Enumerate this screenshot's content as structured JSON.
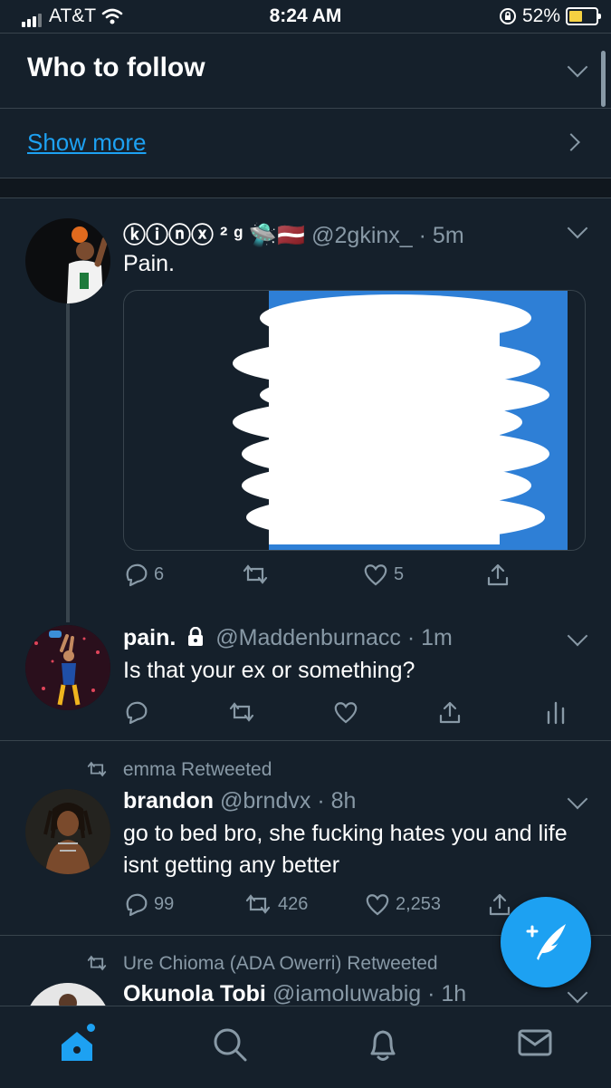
{
  "status_bar": {
    "carrier": "AT&T",
    "time": "8:24 AM",
    "battery_percent": "52%",
    "battery_level": 0.52
  },
  "who_to_follow": {
    "title": "Who to follow",
    "show_more": "Show more"
  },
  "tweets": [
    {
      "display_name": "ⓚⓘⓝⓧ ² ᵍ 🛸🇱🇻",
      "handle": "@2gkinx_",
      "time": "· 5m",
      "text": "Pain.",
      "replies": "6",
      "retweets": "",
      "likes": "5"
    },
    {
      "display_name": "pain.",
      "handle": "@Maddenburnacc",
      "time": "· 1m",
      "text": "Is that your ex or something?",
      "replies": "",
      "retweets": "",
      "likes": ""
    },
    {
      "retweeted_by": "emma Retweeted",
      "display_name": "brandon",
      "handle": "@brndvx",
      "time": "· 8h",
      "text": "go to bed bro, she fucking hates you and life isnt getting any better",
      "replies": "99",
      "retweets": "426",
      "likes": "2,253"
    },
    {
      "retweeted_by": "Ure Chioma (ADA Owerri) Retweeted",
      "display_name": "Okunola Tobi",
      "handle": "@iamoluwabig",
      "time": "· 1h"
    }
  ],
  "icons": {
    "reply": "reply-icon",
    "retweet": "retweet-icon",
    "like": "heart-icon",
    "share": "share-icon",
    "analytics": "analytics-icon",
    "compose": "compose-tweet-icon",
    "home": "home-icon",
    "search": "search-icon",
    "notifications": "bell-icon",
    "messages": "mail-icon"
  },
  "colors": {
    "background": "#15202b",
    "accent": "#1da1f2",
    "muted": "#8899a6",
    "divider": "#38444d"
  }
}
